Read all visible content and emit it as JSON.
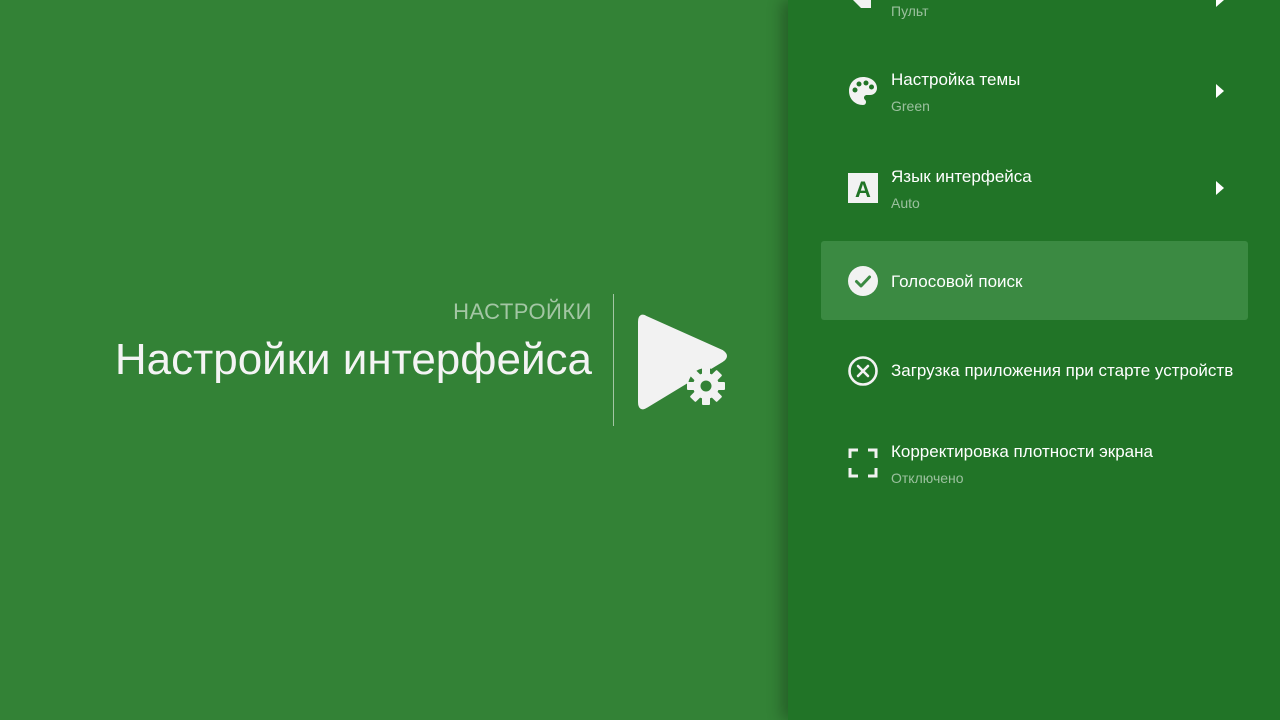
{
  "header": {
    "breadcrumb": "НАСТРОЙКИ",
    "title": "Настройки интерфейса",
    "icon": "play-settings-icon"
  },
  "settings": {
    "items": [
      {
        "label": "",
        "sub": "Пульт",
        "icon": "remote-icon",
        "has_submenu": true
      },
      {
        "label": "Настройка темы",
        "sub": "Green",
        "icon": "palette-icon",
        "has_submenu": true
      },
      {
        "label": "Язык интерфейса",
        "sub": "Auto",
        "icon": "language-icon",
        "has_submenu": true
      },
      {
        "label": "Голосовой поиск",
        "icon": "check-circle-icon",
        "state": "enabled",
        "focused": true
      },
      {
        "label": "Загрузка приложения при старте устройств",
        "icon": "x-circle-icon",
        "state": "disabled"
      },
      {
        "label": "Корректировка плотности экрана",
        "sub": "Отключено",
        "icon": "fullscreen-icon"
      }
    ]
  },
  "colors": {
    "background": "#338236",
    "panel": "#217427",
    "focused_item": "#3b8a42"
  }
}
